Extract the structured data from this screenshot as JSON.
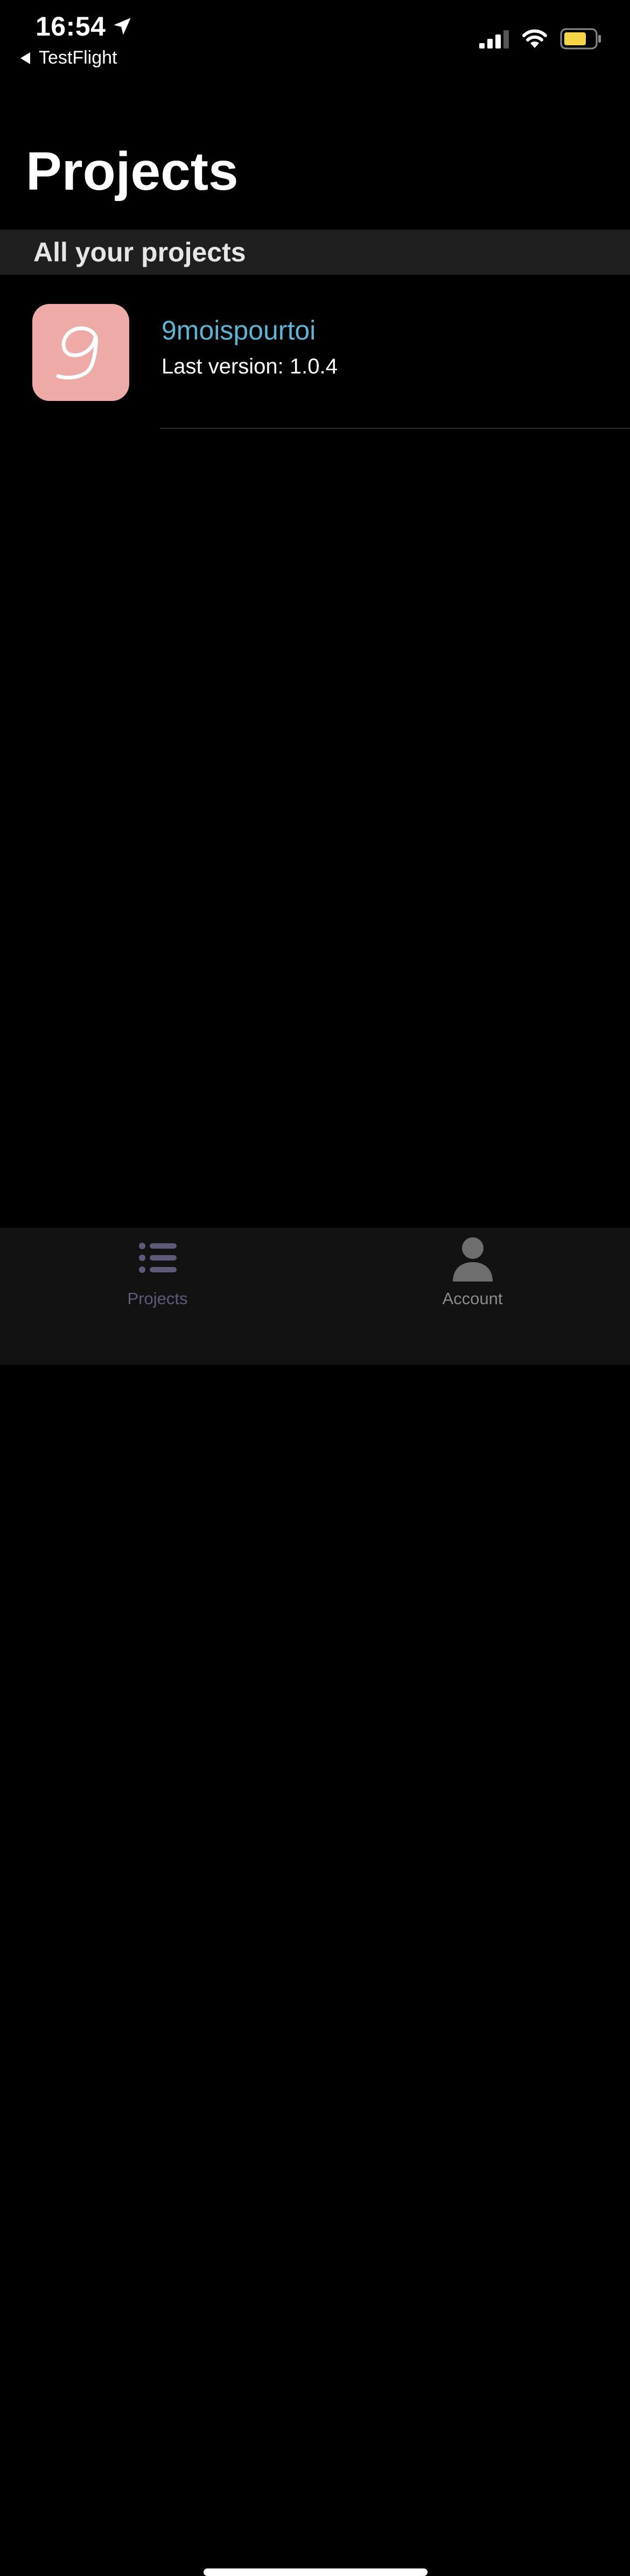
{
  "status_bar": {
    "time": "16:54",
    "back_label": "TestFlight",
    "battery_color": "#f5d547"
  },
  "header": {
    "title": "Projects"
  },
  "section": {
    "label": "All your projects"
  },
  "projects": [
    {
      "name": "9moispourtoi",
      "version_label": "Last version: 1.0.4",
      "icon_name": "app-logo-9moispourtoi",
      "icon_bg": "#eeaaa6",
      "name_color": "#5bb5d4"
    }
  ],
  "tab_bar": {
    "tabs": [
      {
        "label": "Projects",
        "icon": "list-icon",
        "active": true
      },
      {
        "label": "Account",
        "icon": "person-icon",
        "active": false
      }
    ]
  }
}
